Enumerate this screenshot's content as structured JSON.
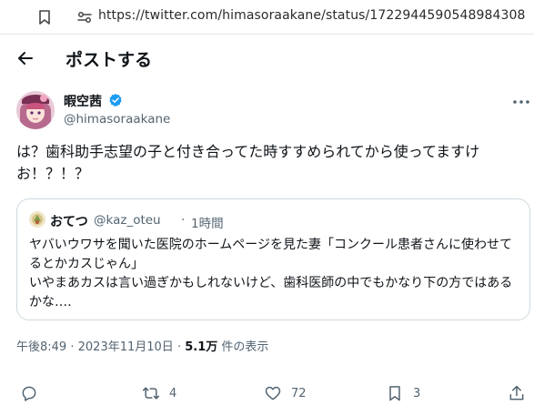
{
  "browser": {
    "url": "https://twitter.com/himasoraakane/status/1722944590548984308"
  },
  "header": {
    "title": "ポストする"
  },
  "author": {
    "name": "暇空茜",
    "handle": "@himasoraakane",
    "verified": true
  },
  "tweet": {
    "text": "は？歯科助手志望の子と付き合ってた時すすめられてから使ってますけお！？！？"
  },
  "quote": {
    "name": "おてつ",
    "handle": "@kaz_oteu",
    "separator": "·",
    "time": "1時間",
    "text_lines": [
      "ヤバいウワサを聞いた医院のホームページを見た妻「コンクール患者さんに使わせてるとかカスじゃん」",
      "いやまあカスは言い過ぎかもしれないけど、歯科医師の中でもかなり下の方ではあるかな‥‥"
    ]
  },
  "meta": {
    "time": "午後8:49",
    "separator": "·",
    "date": "2023年11月10日",
    "separator2": "·",
    "views": "5.1万",
    "views_label": " 件の表示"
  },
  "actions": {
    "reply_count": "",
    "retweet_count": "4",
    "like_count": "72",
    "bookmark_count": "3"
  },
  "colors": {
    "verified": "#1d9bf0",
    "secondary_text": "#536471",
    "primary_text": "#0f1419",
    "border": "#cfd9de"
  }
}
